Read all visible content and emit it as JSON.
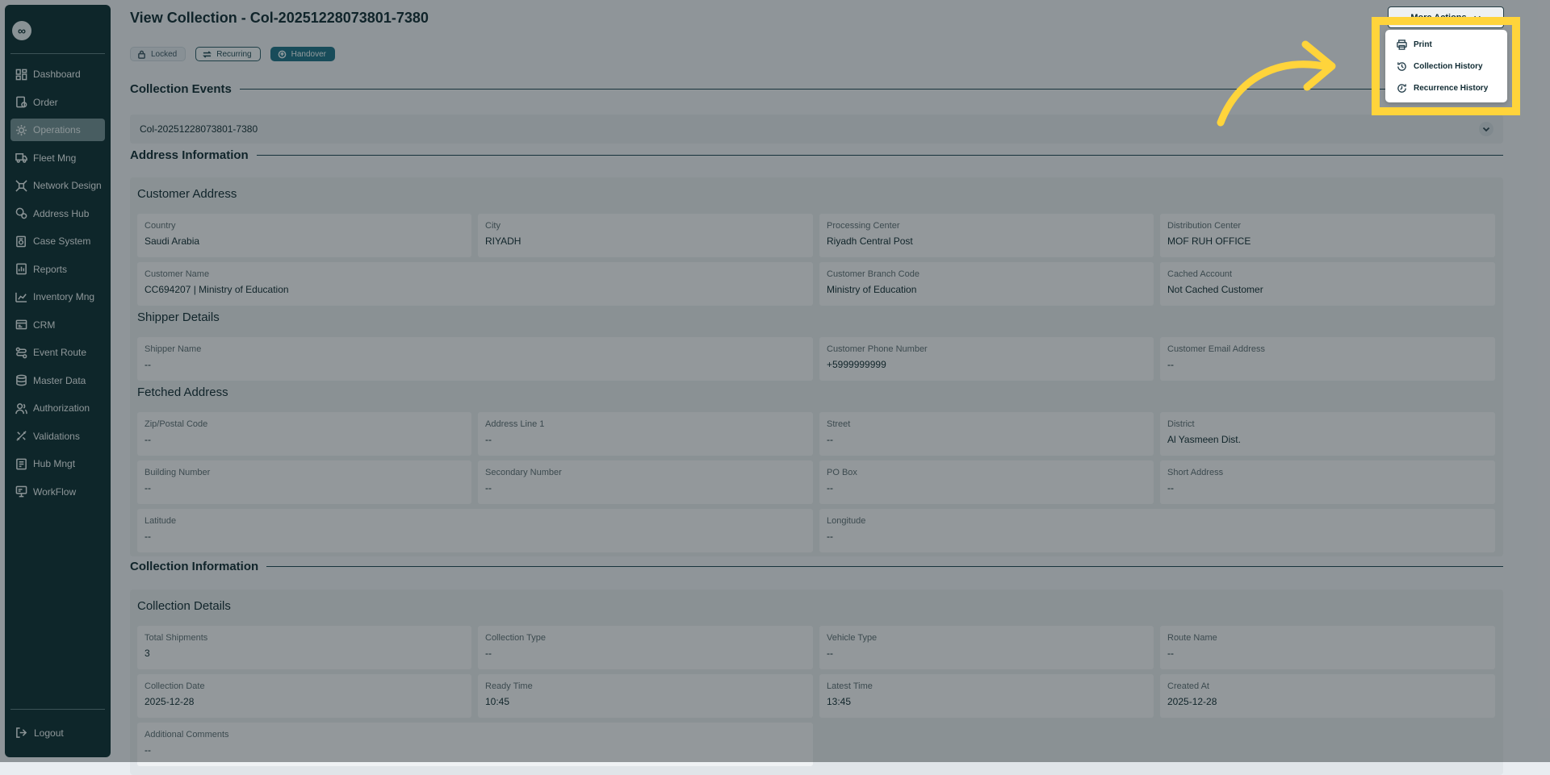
{
  "sidebar": {
    "logo": "∞",
    "items": [
      {
        "label": "Dashboard",
        "icon": "dashboard-icon"
      },
      {
        "label": "Order",
        "icon": "order-icon"
      },
      {
        "label": "Operations",
        "icon": "operations-icon",
        "active": true
      },
      {
        "label": "Fleet Mng",
        "icon": "truck-icon"
      },
      {
        "label": "Network Design",
        "icon": "network-icon"
      },
      {
        "label": "Address Hub",
        "icon": "address-icon"
      },
      {
        "label": "Case System",
        "icon": "case-icon"
      },
      {
        "label": "Reports",
        "icon": "reports-icon"
      },
      {
        "label": "Inventory Mng",
        "icon": "inventory-icon"
      },
      {
        "label": "CRM",
        "icon": "crm-icon"
      },
      {
        "label": "Event Route",
        "icon": "route-icon"
      },
      {
        "label": "Master Data",
        "icon": "database-icon"
      },
      {
        "label": "Authorization",
        "icon": "users-icon"
      },
      {
        "label": "Validations",
        "icon": "validations-icon"
      },
      {
        "label": "Hub Mngt",
        "icon": "hub-icon"
      },
      {
        "label": "WorkFlow",
        "icon": "workflow-icon"
      }
    ],
    "logout": "Logout"
  },
  "page": {
    "title": "View Collection - Col-20251228073801-7380",
    "tags": {
      "locked": "Locked",
      "recurring": "Recurring",
      "handover": "Handover"
    },
    "more_actions": "More Actions"
  },
  "menu": {
    "print": "Print",
    "collection_history": "Collection History",
    "recurrence_history": "Recurrence History"
  },
  "sections": {
    "events": "Collection Events",
    "address": "Address Information",
    "collection": "Collection Information"
  },
  "event_row": "Col-20251228073801-7380",
  "customer_address": {
    "title": "Customer Address",
    "country": {
      "label": "Country",
      "value": "Saudi Arabia"
    },
    "city": {
      "label": "City",
      "value": "RIYADH"
    },
    "processing_center": {
      "label": "Processing Center",
      "value": "Riyadh Central Post"
    },
    "distribution_center": {
      "label": "Distribution Center",
      "value": "MOF RUH OFFICE"
    },
    "customer_name": {
      "label": "Customer Name",
      "value": "CC694207 | Ministry of Education"
    },
    "branch_code": {
      "label": "Customer Branch Code",
      "value": "Ministry of Education"
    },
    "cached_account": {
      "label": "Cached Account",
      "value": "Not Cached Customer"
    }
  },
  "shipper": {
    "title": "Shipper Details",
    "name": {
      "label": "Shipper Name",
      "value": "--"
    },
    "phone": {
      "label": "Customer Phone Number",
      "value": "+5999999999"
    },
    "email": {
      "label": "Customer Email Address",
      "value": "--"
    }
  },
  "fetched": {
    "title": "Fetched Address",
    "zip": {
      "label": "Zip/Postal Code",
      "value": "--"
    },
    "line1": {
      "label": "Address Line 1",
      "value": "--"
    },
    "street": {
      "label": "Street",
      "value": "--"
    },
    "district": {
      "label": "District",
      "value": "Al Yasmeen Dist."
    },
    "building": {
      "label": "Building Number",
      "value": "--"
    },
    "secondary": {
      "label": "Secondary Number",
      "value": "--"
    },
    "pobox": {
      "label": "PO Box",
      "value": "--"
    },
    "short": {
      "label": "Short Address",
      "value": "--"
    },
    "lat": {
      "label": "Latitude",
      "value": "--"
    },
    "lng": {
      "label": "Longitude",
      "value": "--"
    }
  },
  "collection_details": {
    "title": "Collection Details",
    "total_shipments": {
      "label": "Total Shipments",
      "value": "3"
    },
    "collection_type": {
      "label": "Collection Type",
      "value": "--"
    },
    "vehicle_type": {
      "label": "Vehicle Type",
      "value": "--"
    },
    "route_name": {
      "label": "Route Name",
      "value": "--"
    },
    "collection_date": {
      "label": "Collection Date",
      "value": "2025-12-28"
    },
    "ready_time": {
      "label": "Ready Time",
      "value": "10:45"
    },
    "latest_time": {
      "label": "Latest Time",
      "value": "13:45"
    },
    "created_at": {
      "label": "Created At",
      "value": "2025-12-28"
    },
    "comments": {
      "label": "Additional Comments",
      "value": "--"
    }
  },
  "colors": {
    "sidebar": "#0c2d33",
    "accent": "#1d6f85",
    "highlight": "#ffd43b"
  }
}
